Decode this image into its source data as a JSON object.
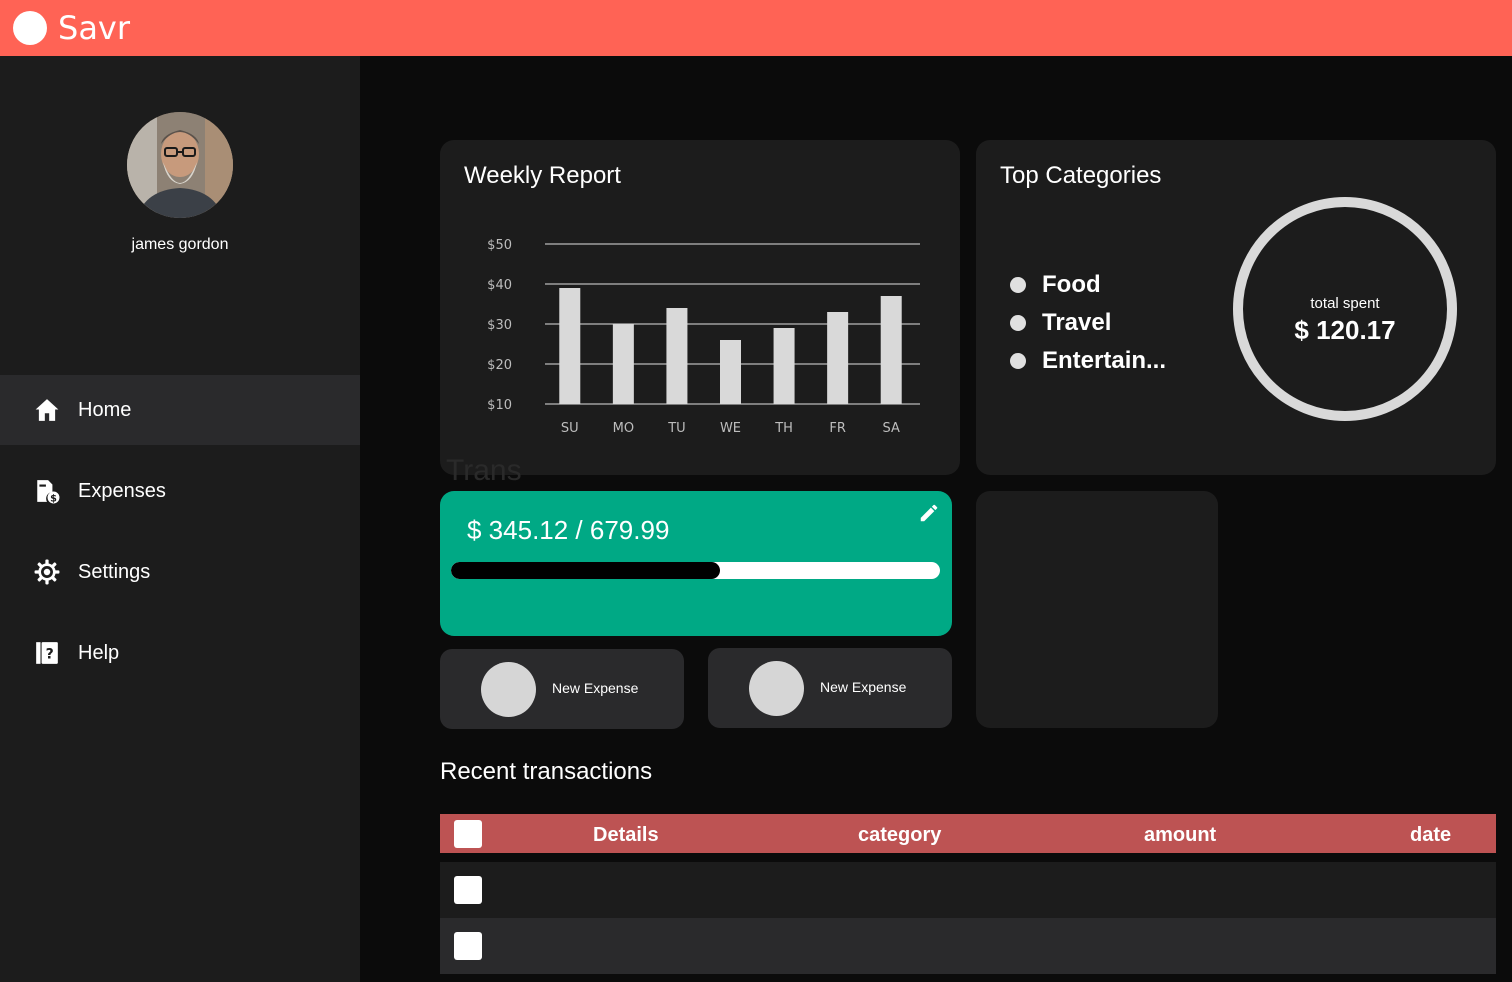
{
  "app": {
    "title": "Savr"
  },
  "user": {
    "name": "james gordon"
  },
  "sidebar": {
    "items": [
      {
        "label": "Home",
        "icon": "home-icon",
        "active": true
      },
      {
        "label": "Expenses",
        "icon": "expenses-icon",
        "active": false
      },
      {
        "label": "Settings",
        "icon": "gear-icon",
        "active": false
      },
      {
        "label": "Help",
        "icon": "help-icon",
        "active": false
      }
    ]
  },
  "weekly_report": {
    "title": "Weekly Report"
  },
  "chart_data": {
    "type": "bar",
    "title": "Weekly Report",
    "categories": [
      "SU",
      "MO",
      "TU",
      "WE",
      "TH",
      "FR",
      "SA"
    ],
    "values": [
      39,
      30,
      34,
      26,
      29,
      33,
      37
    ],
    "y_ticks": [
      "$10",
      "$20",
      "$30",
      "$40",
      "$50"
    ],
    "ylim": [
      10,
      50
    ],
    "grid": true,
    "bar_color": "#d9d9d9"
  },
  "top_categories": {
    "title": "Top Categories",
    "items": [
      "Food",
      "Travel",
      "Entertain..."
    ],
    "total_caption": "total spent",
    "total_value": "$ 120.17"
  },
  "overlap_text": "Trans",
  "budget": {
    "text": "$ 345.12 / 679.99",
    "progress": 0.55,
    "color": "#00a985"
  },
  "actions": [
    {
      "label": "New Expense"
    },
    {
      "label": "New Expense"
    }
  ],
  "recent": {
    "title": "Recent transactions",
    "columns": [
      "Details",
      "category",
      "amount",
      "date"
    ],
    "header_color": "#bd5353"
  },
  "colors": {
    "topbar": "#ff6355",
    "sidebar": "#1c1c1c",
    "background": "#0b0b0b"
  }
}
